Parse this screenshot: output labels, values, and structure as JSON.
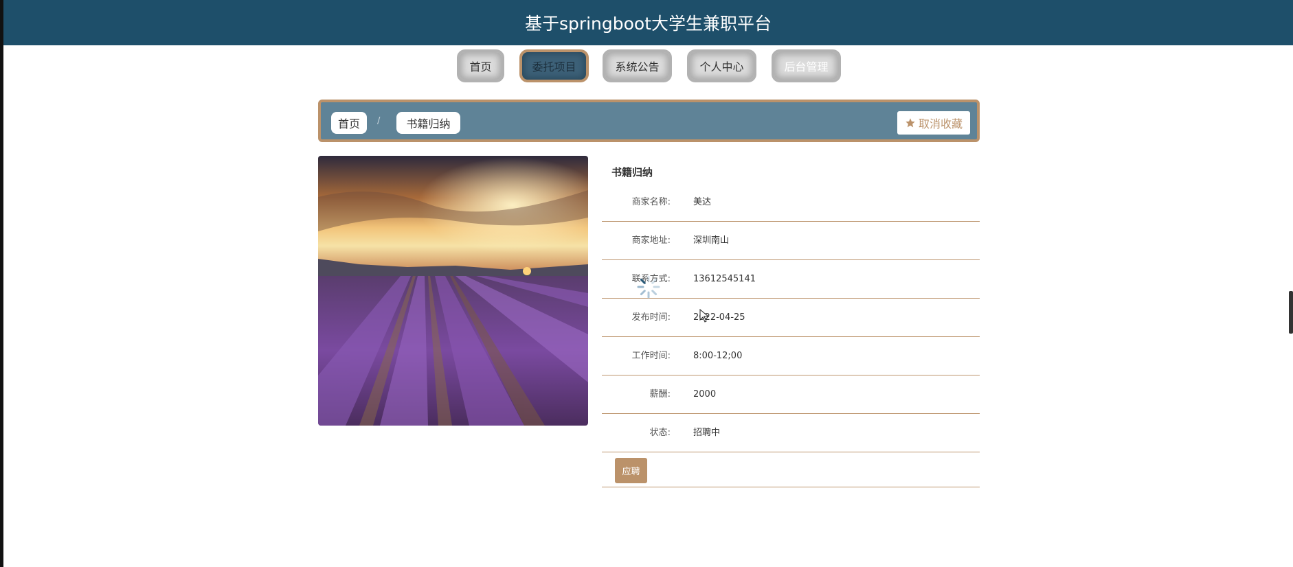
{
  "header": {
    "title": "基于springboot大学生兼职平台"
  },
  "nav": {
    "items": [
      {
        "label": "首页"
      },
      {
        "label": "委托项目"
      },
      {
        "label": "系统公告"
      },
      {
        "label": "个人中心"
      },
      {
        "label": "后台管理"
      }
    ],
    "active": "委托项目"
  },
  "breadcrumb": {
    "home": "首页",
    "separator": "/",
    "current": "书籍归纳",
    "unfavorite_label": "取消收藏",
    "unfavorite_icon": "star-icon"
  },
  "detail": {
    "title": "书籍归纳",
    "rows": [
      {
        "label": "商家名称:",
        "value": "美达"
      },
      {
        "label": "商家地址:",
        "value": "深圳南山"
      },
      {
        "label": "联系方式:",
        "value": "13612545141"
      },
      {
        "label": "发布时间:",
        "value": "2022-04-25"
      },
      {
        "label": "工作时间:",
        "value": "8:00-12;00"
      },
      {
        "label": "薪酬:",
        "value": "2000"
      },
      {
        "label": "状态:",
        "value": "招聘中"
      }
    ],
    "apply_label": "应聘"
  },
  "colors": {
    "header_bg": "#1e4f6a",
    "accent": "#bb926a",
    "breadcrumb_bg": "#5f8397"
  }
}
